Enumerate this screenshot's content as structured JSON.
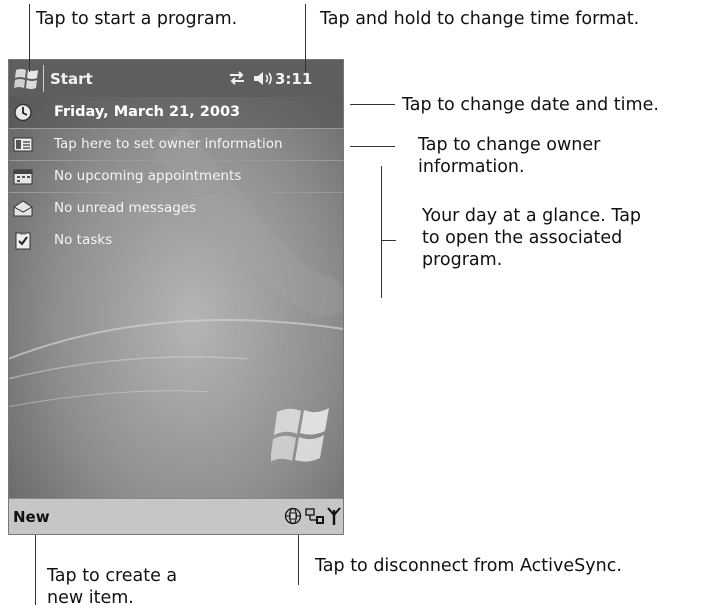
{
  "callouts": {
    "start_program": "Tap to start a program.",
    "time_format": "Tap and hold to change time format.",
    "date_time": "Tap to change date and time.",
    "owner_info": "Tap to change owner\ninformation.",
    "day_glance": "Your day at a glance. Tap\nto open the associated\nprogram.",
    "disconnect": "Tap to disconnect from ActiveSync.",
    "create_item": "Tap to create a\nnew item."
  },
  "device": {
    "titlebar": {
      "start_label": "Start",
      "clock": "3:11"
    },
    "today": {
      "date": "Friday, March 21, 2003",
      "owner": "Tap here to set owner information",
      "appointments": "No upcoming appointments",
      "messages": "No unread messages",
      "tasks": "No tasks"
    },
    "menubar": {
      "new_label": "New"
    }
  },
  "icons": {
    "start": "windows-flag-icon",
    "sync": "sync-arrows-icon",
    "volume": "speaker-volume-icon",
    "clock": "clock-icon",
    "owner": "owner-card-icon",
    "calendar": "calendar-icon",
    "inbox": "envelope-icon",
    "tasks": "task-checklist-icon",
    "network": "globe-network-icon",
    "activesync": "activesync-connection-icon",
    "signal": "antenna-signal-icon"
  },
  "colors": {
    "titlebar": "#5e5e5e",
    "menubar": "#c6c6c6",
    "wallpaper": "#8a8a8a"
  }
}
